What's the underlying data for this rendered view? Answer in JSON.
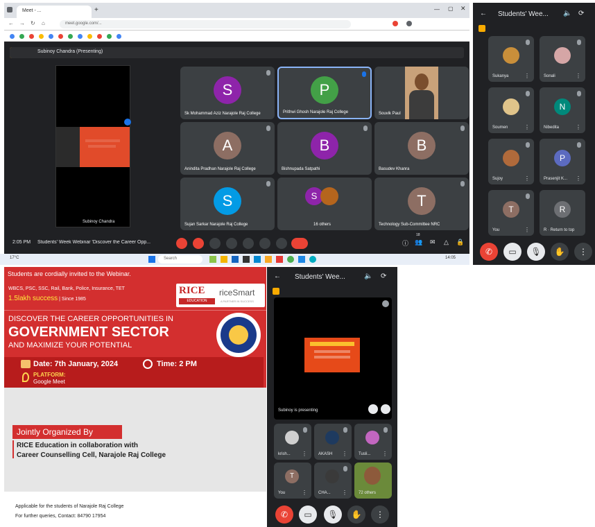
{
  "desktop": {
    "tab_title": "Meet - ...",
    "url": "meet.google.com/...",
    "presenting_label": "Subinoy Chandra (Presenting)",
    "phone_presenter": "Subinoy Chandra",
    "slide_caption": "",
    "time": "2:05 PM",
    "meeting_title": "Students' Week Webinar 'Discover the Career Opp...",
    "participant_count": "18",
    "tiles": [
      {
        "name": "Sk Mohammad Aziz Narajole Raj College",
        "initial": "S",
        "color": "#8e24aa"
      },
      {
        "name": "Prithwi Ghosh Narajole Raj College",
        "initial": "P",
        "color": "#43a047"
      },
      {
        "name": "Souvik Paul",
        "initial": "",
        "color": "#c9a27a"
      },
      {
        "name": "Anindita Pradhan Narajole Raj College",
        "initial": "A",
        "color": "#8d6e63"
      },
      {
        "name": "Bishnupada Satpathi",
        "initial": "B",
        "color": "#8e24aa"
      },
      {
        "name": "Basudev Khanra",
        "initial": "B",
        "color": "#8d6e63"
      },
      {
        "name": "Sujan Sarkar Narajole Raj College",
        "initial": "S",
        "color": "#039be5"
      },
      {
        "name": "16 others",
        "initial": "S",
        "color": "#8e24aa"
      },
      {
        "name": "Technology Sub-Committee NRC",
        "initial": "T",
        "color": "#8d6e63"
      }
    ],
    "weather": "17°C",
    "search_placeholder": "Search",
    "clock": "14:05"
  },
  "phone_right": {
    "title": "Students' Wee...",
    "participants": [
      {
        "name": "Sukanya",
        "initial": "",
        "color": "#c98f3a"
      },
      {
        "name": "Sonali",
        "initial": "",
        "color": "#d5a6a6"
      },
      {
        "name": "Soumen",
        "initial": "",
        "color": "#e0c48a"
      },
      {
        "name": "Nibedita",
        "initial": "N",
        "color": "#00897b"
      },
      {
        "name": "Sujoy",
        "initial": "",
        "color": "#b06a3b"
      },
      {
        "name": "Prasenjit K...",
        "initial": "P",
        "color": "#5c6bc0"
      },
      {
        "name": "You",
        "initial": "T",
        "color": "#8d6e63"
      },
      {
        "name": "R · Return to top",
        "initial": "R",
        "color": "#6d6f73"
      }
    ]
  },
  "poster": {
    "invite": "Students are cordially invited to the Webinar.",
    "exams": "WBCS, PSC, SSC, Rail, Bank, Police, Insurance, TET",
    "success_big": "1.5lakh success",
    "success_since": "Since 1985",
    "rice_logo": "RICE",
    "rice_sub": "EDUCATION",
    "ricesmart": "riceSmart",
    "ricesmart_sub": "A PARTNER IN SUCCESS",
    "headline1": "DISCOVER THE CAREER OPPORTUNITIES IN",
    "headline2": "GOVERNMENT SECTOR",
    "headline3": "AND MAXIMIZE YOUR POTENTIAL",
    "date": "Date: 7th January, 2024",
    "time": "Time: 2 PM",
    "platform_label": "PLATFORM:",
    "platform": "Google Meet",
    "jointly": "Jointly Organized By",
    "org1": "RICE Education in collaboration with",
    "org2": "Career Counselling Cell, Narajole Raj College",
    "applicable": "Applicable for the students of Narajole Raj College",
    "contact": "For further queries, Contact: 84790 17954"
  },
  "phone_bottom": {
    "title": "Students' Wee...",
    "presenting": "Subinoy is presenting",
    "participants": [
      {
        "name": "krish...",
        "initial": "",
        "color": "#cfcfcf"
      },
      {
        "name": "AKASH",
        "initial": "",
        "color": "#1e3a5f"
      },
      {
        "name": "Tusli...",
        "initial": "",
        "color": "#c266c0"
      },
      {
        "name": "You",
        "initial": "T",
        "color": "#8d6e63"
      },
      {
        "name": "CHA...",
        "initial": "",
        "color": "#3a3a3a"
      },
      {
        "name": "72 others",
        "initial": "",
        "color": "#6b8a3a"
      }
    ]
  },
  "colors": {
    "meet_dark": "#202124",
    "tile": "#3c4043",
    "end_call": "#ea4335",
    "poster_red": "#d32f2f"
  }
}
